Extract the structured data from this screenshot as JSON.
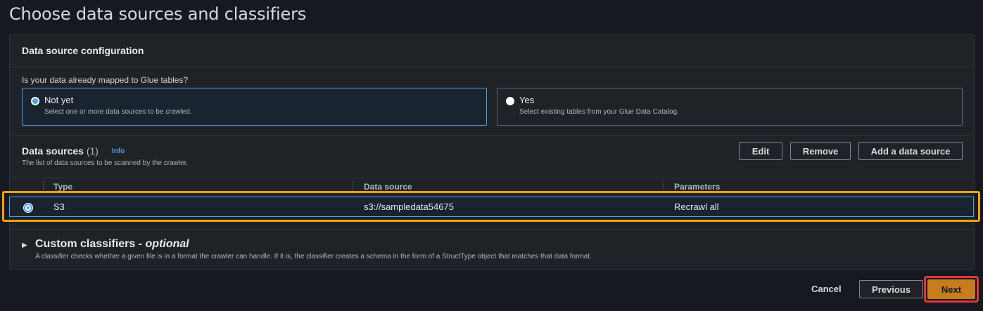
{
  "page": {
    "title": "Choose data sources and classifiers"
  },
  "config": {
    "header": "Data source configuration",
    "question": "Is your data already mapped to Glue tables?",
    "options": [
      {
        "title": "Not yet",
        "description": "Select one or more data sources to be crawled.",
        "selected": true
      },
      {
        "title": "Yes",
        "description": "Select existing tables from your Glue Data Catalog.",
        "selected": false
      }
    ]
  },
  "data_sources": {
    "title": "Data sources",
    "count": "(1)",
    "info": "Info",
    "description": "The list of data sources to be scanned by the crawler.",
    "buttons": {
      "edit": "Edit",
      "remove": "Remove",
      "add": "Add a data source"
    },
    "columns": [
      "Type",
      "Data source",
      "Parameters"
    ],
    "rows": [
      {
        "type": "S3",
        "source": "s3://sampledata54675",
        "parameters": "Recrawl all",
        "selected": true
      }
    ]
  },
  "classifiers": {
    "title": "Custom classifiers -",
    "optional": "optional",
    "description": "A classifier checks whether a given file is in a format the crawler can handle. If it is, the classifier creates a schema in the form of a StructType object that matches that data format."
  },
  "footer": {
    "cancel": "Cancel",
    "previous": "Previous",
    "next": "Next"
  },
  "colors": {
    "accent": "#539fe5",
    "primary": "#c77d1c",
    "highlight_row": "#f0a30a",
    "highlight_next": "#e0373b"
  }
}
